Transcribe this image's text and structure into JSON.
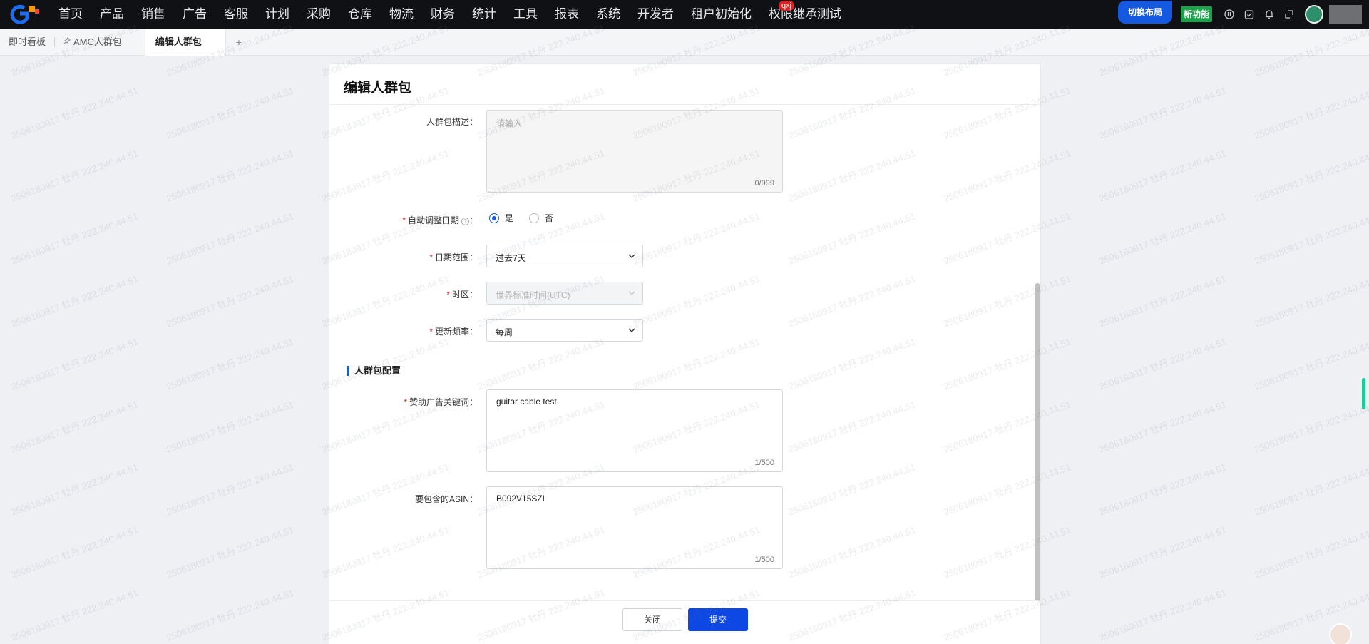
{
  "topnav": {
    "items": [
      "首页",
      "产品",
      "销售",
      "广告",
      "客服",
      "计划",
      "采购",
      "仓库",
      "物流",
      "财务",
      "统计",
      "工具",
      "报表",
      "系统",
      "开发者",
      "租户初始化",
      "权限继承测试"
    ],
    "badge": "qxj",
    "switch_layout": "切换布局",
    "new_feature": "新功能"
  },
  "tabs": {
    "items": [
      "即时看板",
      "AMC人群包",
      "编辑人群包"
    ],
    "add": "+"
  },
  "panel": {
    "title": "编辑人群包"
  },
  "form": {
    "description": {
      "label": "人群包描述：",
      "placeholder": "请输入",
      "count": "0/999"
    },
    "auto_adjust": {
      "label": "自动调整日期",
      "colon": "：",
      "options": [
        "是",
        "否"
      ],
      "selected": "是"
    },
    "date_range": {
      "label": "日期范围：",
      "value": "过去7天"
    },
    "timezone": {
      "label": "时区：",
      "value": "世界标准时间(UTC)"
    },
    "frequency": {
      "label": "更新频率：",
      "value": "每周"
    },
    "section": "人群包配置",
    "keywords": {
      "label": "赞助广告关键词：",
      "value": "guitar cable test",
      "count": "1/500"
    },
    "asin": {
      "label": "要包含的ASIN：",
      "value": "B092V15SZL",
      "count": "1/500"
    }
  },
  "footer": {
    "close": "关闭",
    "submit": "提交"
  },
  "watermark": "2506180917 牡丹 222.240.44.51",
  "colors": {
    "primary": "#1559e0",
    "submit": "#0d47e4",
    "required": "#e02020",
    "topbar": "#0f1114"
  }
}
